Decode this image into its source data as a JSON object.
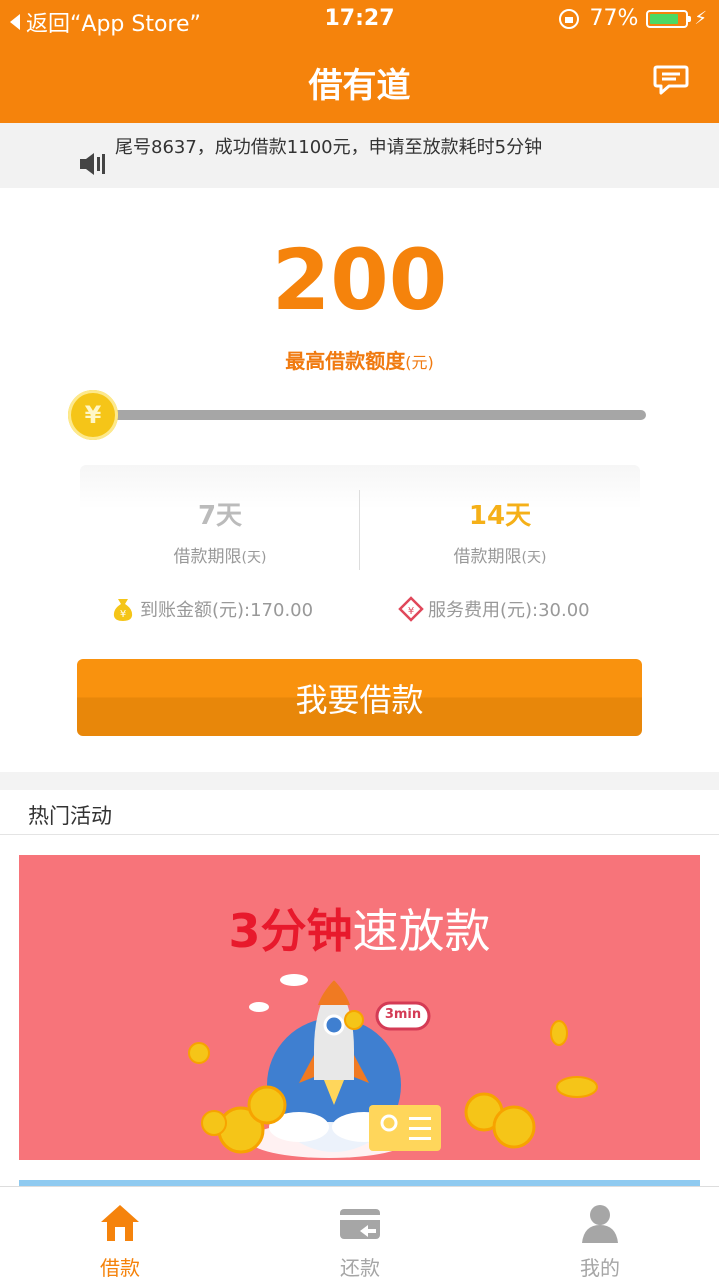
{
  "status_bar": {
    "back_label": "返回“App Store”",
    "time": "17:27",
    "battery": "77%",
    "battery_level": 0.77
  },
  "nav": {
    "title": "借有道",
    "message_icon": "chat-bubble-icon"
  },
  "notice": {
    "text": "尾号8637，成功借款1100元，申请至放款耗时5分钟",
    "icon": "speaker-icon"
  },
  "loan": {
    "amount": "200",
    "amount_label": "最高借款额度",
    "amount_unit": "(元)",
    "slider_symbol": "¥",
    "slider_position": 0,
    "terms": [
      {
        "days": "7天",
        "label": "借款期限",
        "unit": "(天)",
        "selected": false
      },
      {
        "days": "14天",
        "label": "借款期限",
        "unit": "(天)",
        "selected": true
      }
    ],
    "received": "到账金额(元):170.00",
    "fee": "服务费用(元):30.00",
    "button": "我要借款"
  },
  "activities": {
    "title": "热门活动",
    "banner_title_strong": "3分钟",
    "banner_title_rest": "速放款",
    "banner_badge": "3min"
  },
  "tabs": [
    {
      "label": "借款",
      "icon": "home-icon",
      "active": true
    },
    {
      "label": "还款",
      "icon": "wallet-return-icon",
      "active": false
    },
    {
      "label": "我的",
      "icon": "user-icon",
      "active": false
    }
  ],
  "colors": {
    "brand": "#f5830c",
    "inactive": "#a6a6a6",
    "banner": "#f7747a"
  }
}
